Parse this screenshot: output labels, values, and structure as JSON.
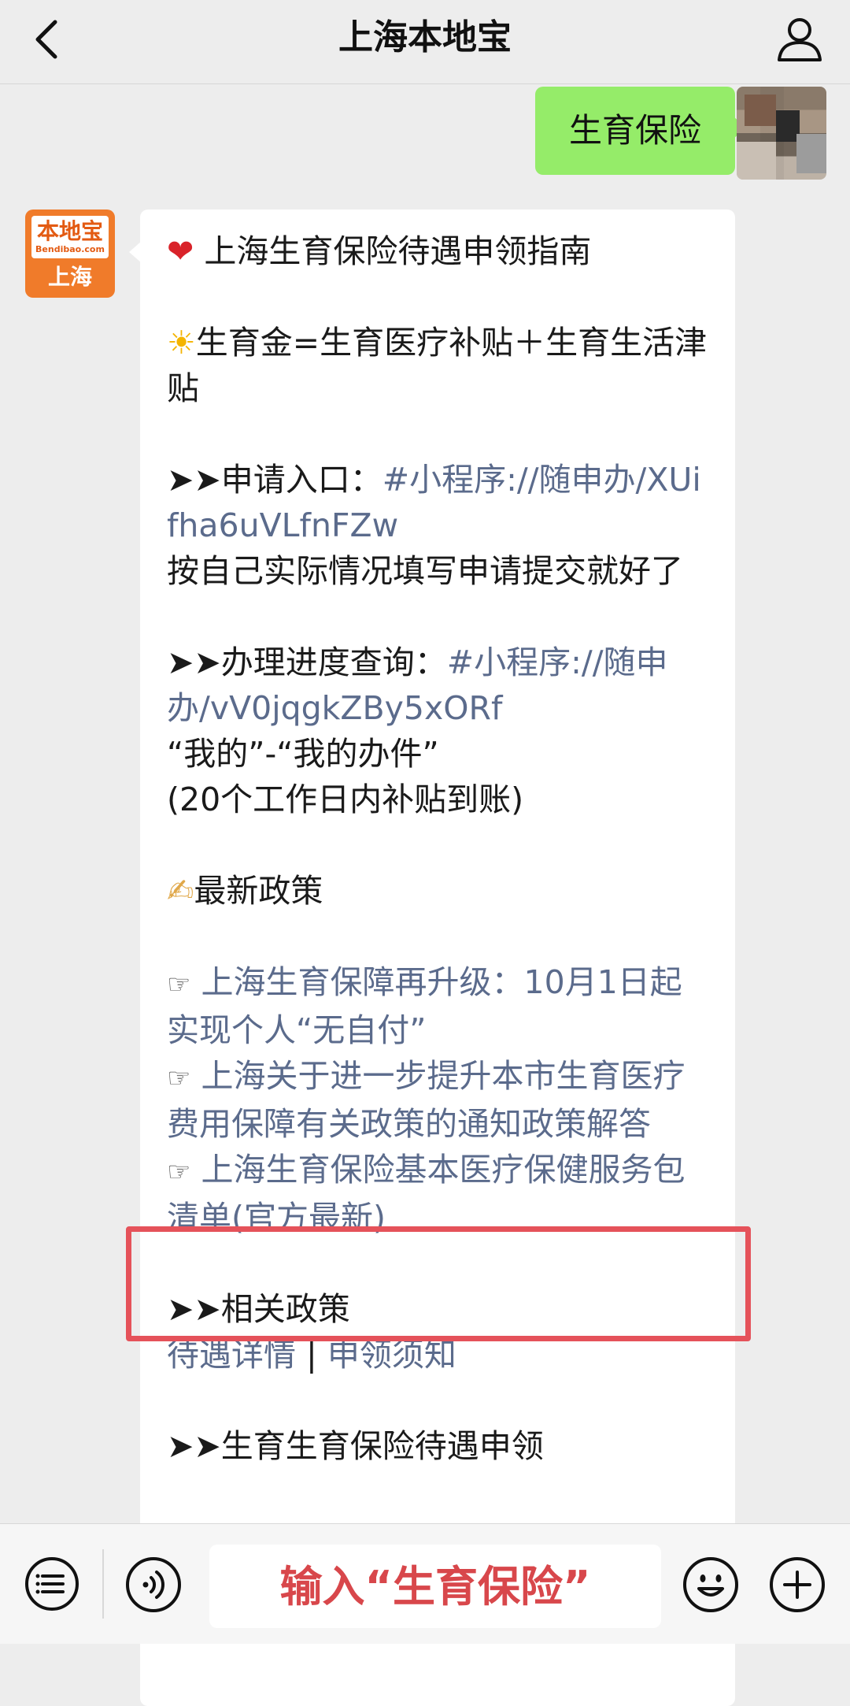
{
  "header": {
    "title": "上海本地宝",
    "back_icon": "chevron-left-icon",
    "profile_icon": "person-icon"
  },
  "outgoing_message": {
    "text": "生育保险"
  },
  "bot_avatar": {
    "logo_text": "本地宝",
    "logo_sub": "Bendibao.com",
    "city": "上海"
  },
  "incoming_message": {
    "title": "上海生育保险待遇申领指南",
    "formula": "生育金=生育医疗补贴＋生育生活津贴",
    "apply_label": "申请入口：",
    "apply_link": "#小程序://随申办/XUifha6uVLfnFZw",
    "apply_note": "按自己实际情况填写申请提交就好了",
    "progress_label": "办理进度查询：",
    "progress_link": "#小程序://随申办/vV0jqgkZBy5xORf",
    "progress_path": "“我的”-“我的办件”",
    "progress_note": "(20个工作日内补贴到账)",
    "policy_heading": "最新政策",
    "policy_links": [
      "上海生育保障再升级：10月1日起实现个人“无自付”",
      "上海关于进一步提升本市生育医疗费用保障有关政策的通知政策解答",
      "上海生育保险基本医疗保健服务包清单(官方最新)"
    ],
    "related_heading": "相关政策",
    "related_links": [
      "待遇详情",
      "申领须知"
    ],
    "related_separator": "|",
    "next_heading": "生育生育保险待遇申领"
  },
  "input_bar": {
    "placeholder": "输入“生育保险”",
    "icons": [
      "menu-list-icon",
      "voice-icon",
      "emoji-icon",
      "plus-icon"
    ]
  },
  "colors": {
    "link": "#5b6b8c",
    "highlight": "#e5525a",
    "outgoing_bubble": "#95ec69",
    "background": "#ededed"
  }
}
